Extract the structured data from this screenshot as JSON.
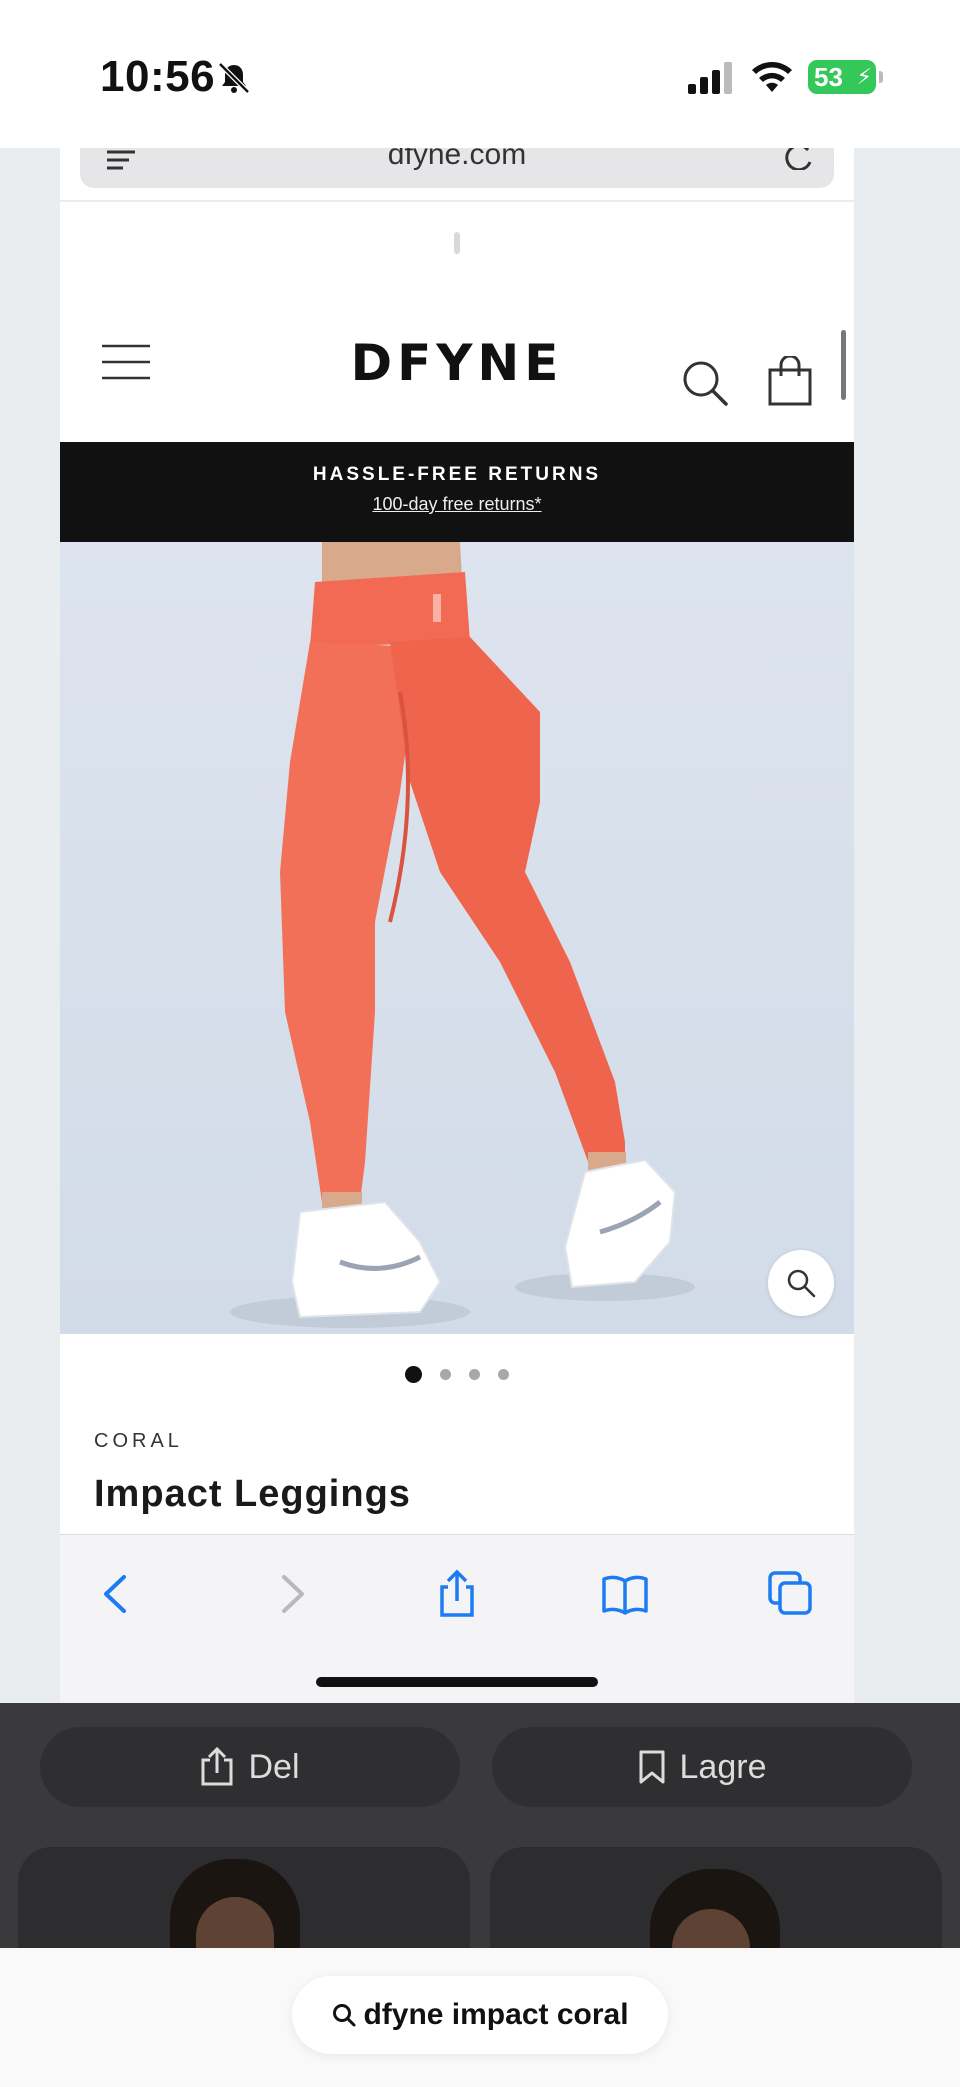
{
  "status_bar": {
    "time": "10:56",
    "battery": "53"
  },
  "browser": {
    "url": "dfyne.com"
  },
  "site": {
    "logo": "DFYNE",
    "promo_title": "HASSLE-FREE RETURNS",
    "promo_link": "100-day free returns*"
  },
  "product": {
    "color": "CORAL",
    "title": "Impact Leggings",
    "image_count": 4,
    "active_image": 1
  },
  "sheet": {
    "share_label": "Del",
    "save_label": "Lagre"
  },
  "search": {
    "query": "dfyne impact coral"
  },
  "colors": {
    "accent": "#1d7cf2",
    "promo_bg": "#111111",
    "leggings": "#f26a54"
  }
}
